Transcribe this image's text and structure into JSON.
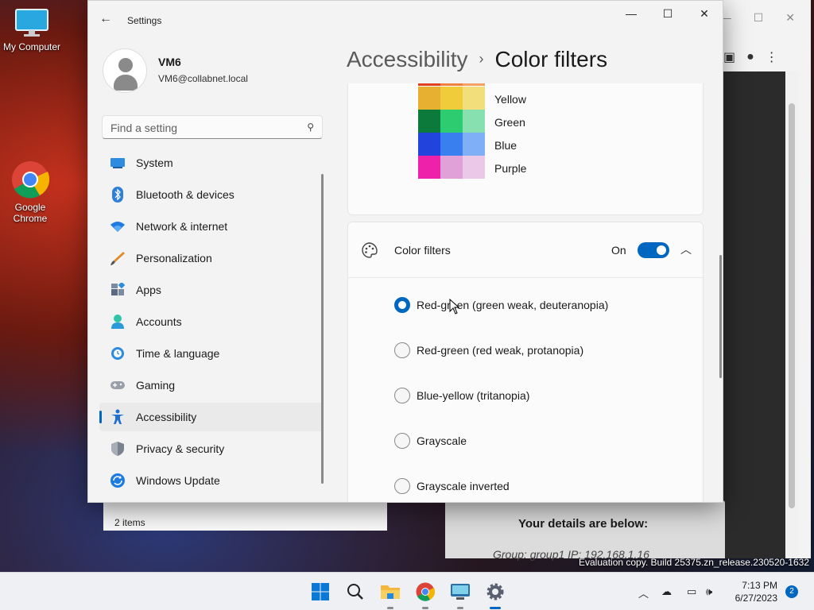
{
  "desktop": {
    "icons": [
      {
        "label": "My Computer"
      },
      {
        "label": "Google Chrome"
      }
    ],
    "watermark": "Evaluation copy. Build 25375.zn_release.230520-1632"
  },
  "browser_bg": {
    "details_title": "Your details are below:",
    "details_line": "Group: group1   IP: 192.168.1.16"
  },
  "explorer_bg": {
    "status": "2 items"
  },
  "settings": {
    "window_title": "Settings",
    "user": {
      "name": "VM6",
      "email": "VM6@collabnet.local"
    },
    "search": {
      "placeholder": "Find a setting"
    },
    "nav": [
      {
        "label": "System",
        "icon": "system-icon"
      },
      {
        "label": "Bluetooth & devices",
        "icon": "bluetooth-icon"
      },
      {
        "label": "Network & internet",
        "icon": "wifi-icon"
      },
      {
        "label": "Personalization",
        "icon": "brush-icon"
      },
      {
        "label": "Apps",
        "icon": "apps-icon"
      },
      {
        "label": "Accounts",
        "icon": "accounts-icon"
      },
      {
        "label": "Time & language",
        "icon": "clock-icon"
      },
      {
        "label": "Gaming",
        "icon": "gamepad-icon"
      },
      {
        "label": "Accessibility",
        "icon": "accessibility-icon",
        "active": true
      },
      {
        "label": "Privacy & security",
        "icon": "shield-icon"
      },
      {
        "label": "Windows Update",
        "icon": "update-icon"
      }
    ],
    "breadcrumb": {
      "parent": "Accessibility",
      "current": "Color filters"
    },
    "swatches": [
      {
        "label": "Yellow",
        "colors": [
          "#e8b030",
          "#f0cc3a",
          "#f2de7a"
        ]
      },
      {
        "label": "Green",
        "colors": [
          "#0b7a3a",
          "#2ecc71",
          "#86e0b0"
        ]
      },
      {
        "label": "Blue",
        "colors": [
          "#2244dd",
          "#3a7ff0",
          "#7fb0f5"
        ]
      },
      {
        "label": "Purple",
        "colors": [
          "#ee22aa",
          "#e0a0d8",
          "#ecc8e8"
        ]
      }
    ],
    "color_filters": {
      "label": "Color filters",
      "state": "On",
      "options": [
        {
          "label": "Red-green (green weak, deuteranopia)",
          "selected": true
        },
        {
          "label": "Red-green (red weak, protanopia)",
          "selected": false
        },
        {
          "label": "Blue-yellow (tritanopia)",
          "selected": false
        },
        {
          "label": "Grayscale",
          "selected": false
        },
        {
          "label": "Grayscale inverted",
          "selected": false
        }
      ]
    },
    "accent": "#0067c0"
  },
  "taskbar": {
    "time": "7:13 PM",
    "date": "6/27/2023",
    "notifications": "2"
  }
}
